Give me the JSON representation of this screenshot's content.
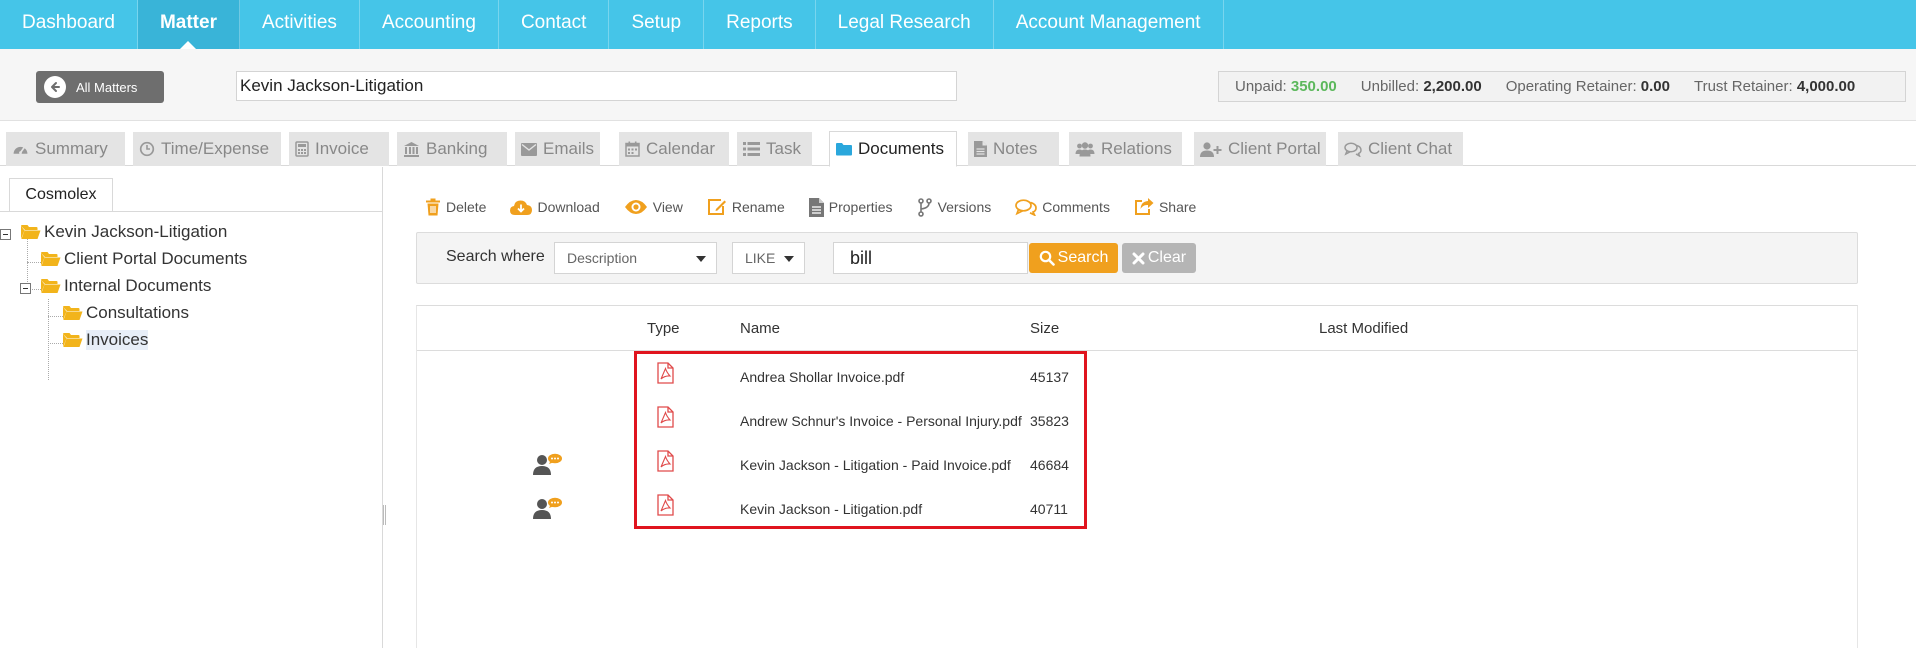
{
  "nav": {
    "items": [
      {
        "label": "Dashboard",
        "active": false
      },
      {
        "label": "Matter",
        "active": true
      },
      {
        "label": "Activities",
        "active": false
      },
      {
        "label": "Accounting",
        "active": false
      },
      {
        "label": "Contact",
        "active": false
      },
      {
        "label": "Setup",
        "active": false
      },
      {
        "label": "Reports",
        "active": false
      },
      {
        "label": "Legal Research",
        "active": false
      },
      {
        "label": "Account Management",
        "active": false
      }
    ]
  },
  "header": {
    "all_matters_label": "All Matters",
    "matter_name": "Kevin Jackson-Litigation",
    "totals": {
      "unpaid_label": "Unpaid:",
      "unpaid_value": "350.00",
      "unbilled_label": "Unbilled:",
      "unbilled_value": "2,200.00",
      "operating_label": "Operating Retainer:",
      "operating_value": "0.00",
      "trust_label": "Trust Retainer:",
      "trust_value": "4,000.00"
    }
  },
  "tabs": [
    {
      "label": "Summary",
      "icon": "dashboard-icon"
    },
    {
      "label": "Time/Expense",
      "icon": "clock-icon"
    },
    {
      "label": "Invoice",
      "icon": "calculator-icon"
    },
    {
      "label": "Banking",
      "icon": "bank-icon"
    },
    {
      "label": "Emails",
      "icon": "envelope-icon"
    },
    {
      "label": "Calendar",
      "icon": "calendar-icon"
    },
    {
      "label": "Task",
      "icon": "list-icon"
    },
    {
      "label": "Documents",
      "icon": "folder-icon",
      "active": true
    },
    {
      "label": "Notes",
      "icon": "file-text-icon"
    },
    {
      "label": "Relations",
      "icon": "users-icon"
    },
    {
      "label": "Client Portal",
      "icon": "user-plus-icon"
    },
    {
      "label": "Client Chat",
      "icon": "comments-icon"
    }
  ],
  "tree": {
    "tab_label": "Cosmolex",
    "root": "Kevin Jackson-Litigation",
    "client_portal": "Client Portal Documents",
    "internal": "Internal Documents",
    "consultations": "Consultations",
    "invoices": "Invoices"
  },
  "toolbar": {
    "delete": "Delete",
    "download": "Download",
    "view": "View",
    "rename": "Rename",
    "properties": "Properties",
    "versions": "Versions",
    "comments": "Comments",
    "share": "Share"
  },
  "search": {
    "label": "Search where",
    "field": "Description",
    "operator": "LIKE",
    "value": "bill",
    "search_button": "Search",
    "clear_button": "Clear"
  },
  "grid": {
    "columns": {
      "type": "Type",
      "name": "Name",
      "size": "Size",
      "modified": "Last Modified"
    },
    "rows": [
      {
        "name": "Andrea Shollar Invoice.pdf",
        "size": "45137",
        "shared": false
      },
      {
        "name": "Andrew Schnur's Invoice - Personal Injury.pdf",
        "size": "35823",
        "shared": false
      },
      {
        "name": "Kevin Jackson - Litigation - Paid Invoice.pdf",
        "size": "46684",
        "shared": true
      },
      {
        "name": "Kevin Jackson - Litigation.pdf",
        "size": "40711",
        "shared": true
      }
    ]
  },
  "colors": {
    "nav_bg": "#45c5e8",
    "accent_orange": "#f0a01e",
    "unpaid_green": "#5cb85c",
    "highlight_red": "#e0141e"
  }
}
